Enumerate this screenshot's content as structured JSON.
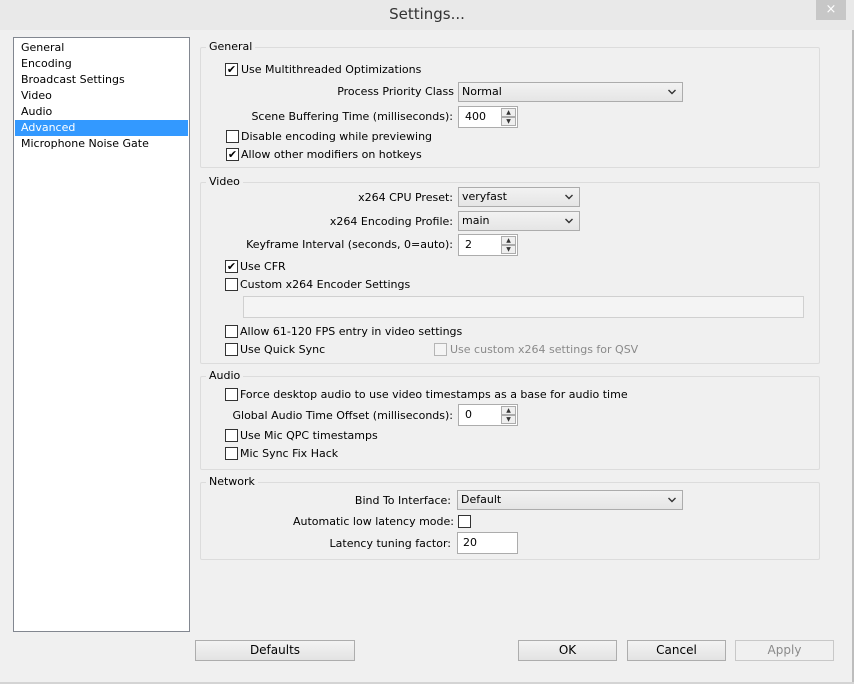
{
  "window": {
    "title": "Settings...",
    "close_glyph": "×"
  },
  "sidebar": {
    "items": [
      {
        "label": "General"
      },
      {
        "label": "Encoding"
      },
      {
        "label": "Broadcast Settings"
      },
      {
        "label": "Video"
      },
      {
        "label": "Audio"
      },
      {
        "label": "Advanced",
        "selected": true
      },
      {
        "label": "Microphone Noise Gate"
      }
    ]
  },
  "general": {
    "title": "General",
    "multithreaded": {
      "label": "Use Multithreaded Optimizations",
      "checked": true
    },
    "priority": {
      "label": "Process Priority Class",
      "value": "Normal"
    },
    "buffering": {
      "label": "Scene Buffering Time (milliseconds):",
      "value": "400"
    },
    "disable_preview": {
      "label": "Disable encoding while previewing",
      "checked": false
    },
    "hotkey_modifiers": {
      "label": "Allow other modifiers on hotkeys",
      "checked": true
    }
  },
  "video": {
    "title": "Video",
    "cpu_preset": {
      "label": "x264 CPU Preset:",
      "value": "veryfast"
    },
    "profile": {
      "label": "x264 Encoding Profile:",
      "value": "main"
    },
    "keyframe": {
      "label": "Keyframe Interval (seconds, 0=auto):",
      "value": "2"
    },
    "use_cfr": {
      "label": "Use CFR",
      "checked": true
    },
    "custom_x264": {
      "label": "Custom x264 Encoder Settings",
      "checked": false,
      "value": ""
    },
    "fps_entry": {
      "label": "Allow 61-120 FPS entry in video settings",
      "checked": false
    },
    "quick_sync": {
      "label": "Use Quick Sync",
      "checked": false
    },
    "qsv_custom": {
      "label": "Use custom x264 settings for QSV",
      "checked": false
    }
  },
  "audio": {
    "title": "Audio",
    "force_desktop": {
      "label": "Force desktop audio to use video timestamps as a base for audio time",
      "checked": false
    },
    "offset": {
      "label": "Global Audio Time Offset (milliseconds):",
      "value": "0"
    },
    "mic_qpc": {
      "label": "Use Mic QPC timestamps",
      "checked": false
    },
    "mic_sync": {
      "label": "Mic Sync Fix Hack",
      "checked": false
    }
  },
  "network": {
    "title": "Network",
    "bind": {
      "label": "Bind To Interface:",
      "value": "Default"
    },
    "low_latency": {
      "label": "Automatic low latency mode:",
      "checked": false
    },
    "tuning": {
      "label": "Latency tuning factor:",
      "value": "20"
    }
  },
  "footer": {
    "defaults": "Defaults",
    "ok": "OK",
    "cancel": "Cancel",
    "apply": "Apply"
  },
  "glyphs": {
    "check": "✔",
    "up": "▲",
    "down": "▼"
  }
}
